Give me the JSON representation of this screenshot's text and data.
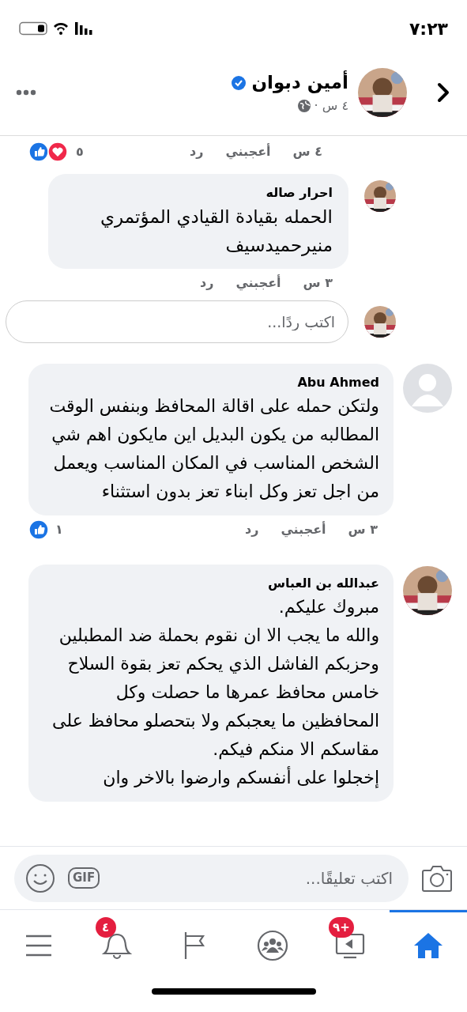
{
  "status_bar": {
    "time": "٧:٢٣"
  },
  "post_header": {
    "author": "أمين دبوان",
    "verified": true,
    "time": "٤ س ·"
  },
  "previous_reply_meta": {
    "time": "٤ س",
    "like": "أعجبني",
    "reply": "رد",
    "reactions_count": "٥"
  },
  "replies": [
    {
      "author": "احرار صاله",
      "text": "الحمله بقيادة القيادي المؤتمري منيرحميدسيف",
      "time": "٣ س",
      "like": "أعجبني",
      "reply": "رد"
    }
  ],
  "reply_box": {
    "placeholder": "اكتب ردًا..."
  },
  "comments": [
    {
      "author": "Abu Ahmed",
      "kind": "silhouette",
      "paragraphs": [
        "ولتكن حمله على اقالة المحافظ وبنفس الوقت المطالبه من يكون البديل اين مايكون اهم شي الشخص المناسب في المكان المناسب ويعمل من اجل تعز وكل ابناء تعز بدون استثناء"
      ],
      "time": "٣ س",
      "like": "أعجبني",
      "reply": "رد",
      "reactions_count": "١"
    },
    {
      "author": "عبدالله بن العباس",
      "paragraphs": [
        "مبروك عليكم.",
        "والله ما يجب الا ان نقوم بحملة ضد المطبلين وحزبكم الفاشل الذي يحكم تعز بقوة السلاح خامس محافظ عمرها ما حصلت وكل المحافظين ما يعجبكم ولا بتحصلو محافظ على مقاسكم الا منكم فيكم.",
        "إخجلوا على أنفسكم وارضوا بالاخر وان"
      ]
    }
  ],
  "composer": {
    "placeholder": "اكتب تعليقًا...",
    "gif": "GIF"
  },
  "bottom_nav": [
    {
      "kind": "home",
      "selected": true
    },
    {
      "kind": "video",
      "badge": "٩+",
      "selected": false
    },
    {
      "kind": "groups",
      "selected": false
    },
    {
      "kind": "flag",
      "selected": false
    },
    {
      "kind": "bell",
      "badge": "٤",
      "selected": false
    },
    {
      "kind": "menu",
      "selected": false
    }
  ]
}
